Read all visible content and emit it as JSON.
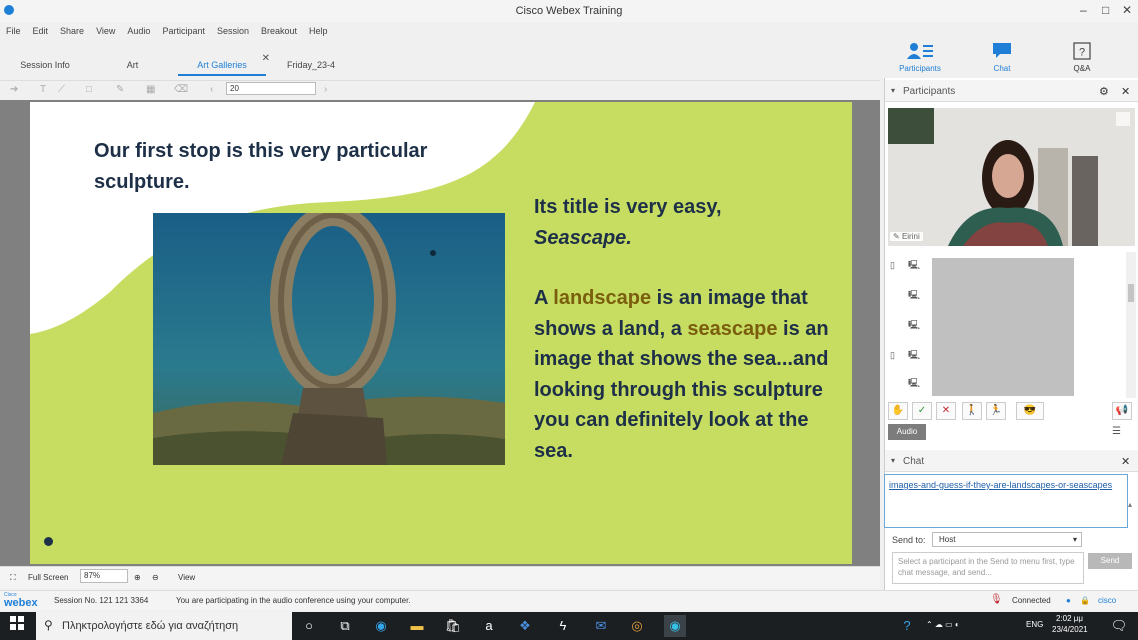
{
  "window": {
    "title": "Cisco Webex Training",
    "controls": [
      "–",
      "□",
      "✕"
    ]
  },
  "menu": [
    "File",
    "Edit",
    "Share",
    "View",
    "Audio",
    "Participant",
    "Session",
    "Breakout",
    "Help"
  ],
  "tabs": [
    {
      "label": "Session Info"
    },
    {
      "label": "Art"
    },
    {
      "label": "Art Galleries",
      "close": "✕"
    },
    {
      "label": "Friday_23-4"
    }
  ],
  "right_toolbar": [
    {
      "label": "Participants",
      "icon": "participants-icon"
    },
    {
      "label": "Chat",
      "icon": "chat-icon"
    },
    {
      "label": "Q&A",
      "icon": "qa-icon"
    }
  ],
  "annotation_toolbar": {
    "page_value": "20"
  },
  "slide": {
    "title": "Our first stop is this very particular sculpture.",
    "body_line1": "Its title is very easy,",
    "body_line2": "Seascape.",
    "para_a": "A ",
    "word_landscape": "landscape",
    "para_b": " is an image that shows a land, a ",
    "word_seascape": "seascape",
    "para_c": " is an image that shows the sea...and looking through this sculpture you can definitely look at the sea.",
    "colors": {
      "background": "#c7dd62",
      "text": "#1e3048",
      "accent": "#7a5e0e"
    }
  },
  "bottom_bar": {
    "full_screen": "Full Screen",
    "zoom": "87%",
    "view": "View"
  },
  "participants_panel": {
    "title": "Participants",
    "video_name": "Eirini",
    "audio_button": "Audio"
  },
  "chat_panel": {
    "title": "Chat",
    "message": "images-and-guess-if-they-are-landscapes-or-seascapes",
    "send_to_label": "Send to:",
    "send_to_value": "Host",
    "input_placeholder": "Select a participant in the Send to menu first, type chat message, and send...",
    "send_button": "Send"
  },
  "status_bar": {
    "logo_small": "Cisco",
    "logo_big": "webex",
    "session_no": "Session No. 121 121 3364",
    "audio_msg": "You are participating in the audio conference using your computer.",
    "connected": "Connected",
    "cisco": "cisco"
  },
  "taskbar": {
    "search_placeholder": "Πληκτρολογήστε εδώ για αναζήτηση",
    "lang": "ENG",
    "time": "2:02 μμ",
    "date": "23/4/2021"
  }
}
